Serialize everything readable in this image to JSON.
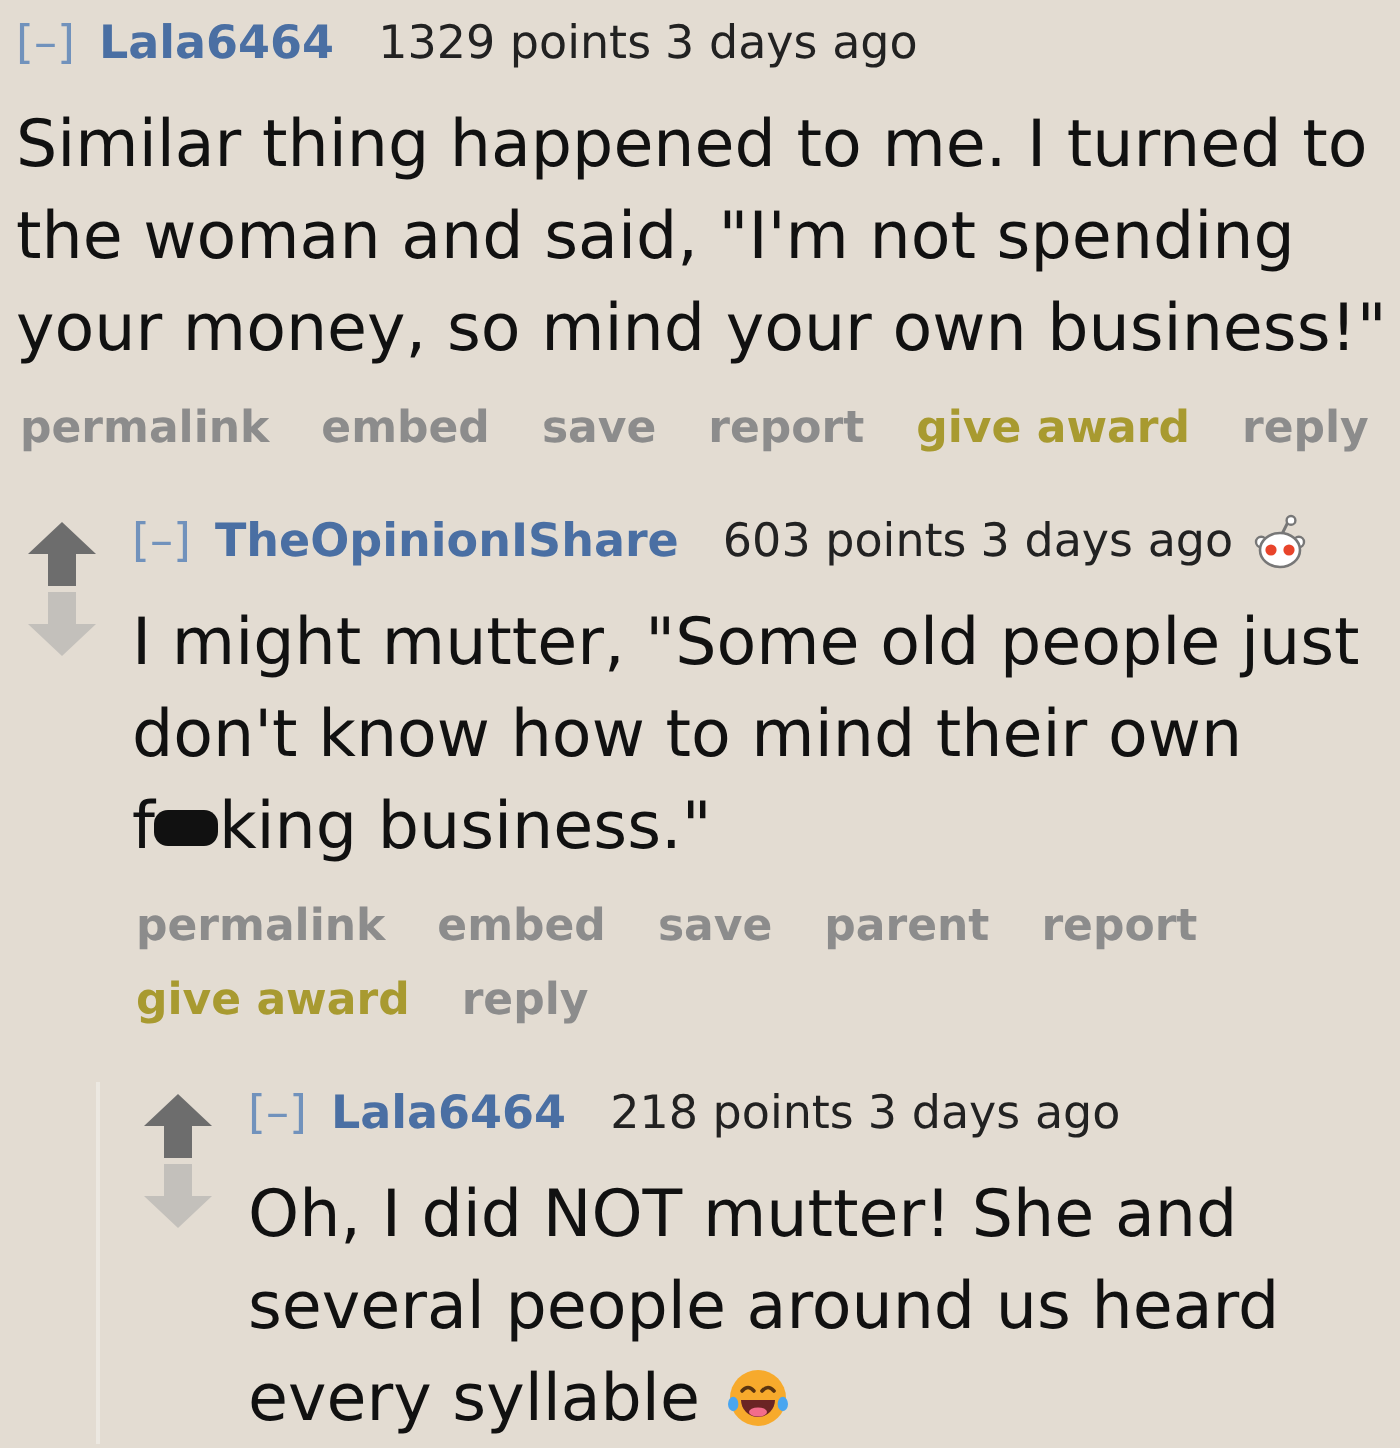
{
  "thread": {
    "comments": [
      {
        "collapse_toggle": "[–]",
        "author": "Lala6464",
        "score": "1329 points",
        "age": "3 days ago",
        "vote_arrows": false,
        "award_icon": false,
        "body": [
          {
            "kind": "text",
            "text": "Similar thing happened to me. I turned to the woman and said, \"I'm not spending your money, so mind your own business!\""
          }
        ],
        "actions": [
          {
            "kind": "link",
            "label": "permalink"
          },
          {
            "kind": "link",
            "label": "embed"
          },
          {
            "kind": "link",
            "label": "save"
          },
          {
            "kind": "link",
            "label": "report"
          },
          {
            "kind": "award",
            "label": "give award"
          },
          {
            "kind": "link",
            "label": "reply"
          }
        ],
        "children": [
          {
            "collapse_toggle": "[–]",
            "author": "TheOpinionIShare",
            "score": "603 points",
            "age": "3 days ago",
            "vote_arrows": true,
            "award_icon": true,
            "body": [
              {
                "kind": "text",
                "text": "I might mutter, \"Some old people just don't know how to mind their own"
              },
              {
                "kind": "text",
                "text": "f"
              },
              {
                "kind": "censor"
              },
              {
                "kind": "text",
                "text": "king business.\""
              }
            ],
            "actions": [
              {
                "kind": "link",
                "label": "permalink"
              },
              {
                "kind": "link",
                "label": "embed"
              },
              {
                "kind": "link",
                "label": "save"
              },
              {
                "kind": "link",
                "label": "parent"
              },
              {
                "kind": "link",
                "label": "report"
              },
              {
                "kind": "award",
                "label": "give award"
              },
              {
                "kind": "link",
                "label": "reply"
              }
            ],
            "children": [
              {
                "collapse_toggle": "[–]",
                "author": "Lala6464",
                "score": "218 points",
                "age": "3 days ago",
                "vote_arrows": true,
                "award_icon": false,
                "body": [
                  {
                    "kind": "text",
                    "text": "Oh, I did NOT mutter! She and several people around us heard"
                  },
                  {
                    "kind": "text",
                    "text": "every syllable"
                  },
                  {
                    "kind": "emoji"
                  }
                ]
              }
            ]
          }
        ]
      }
    ]
  }
}
